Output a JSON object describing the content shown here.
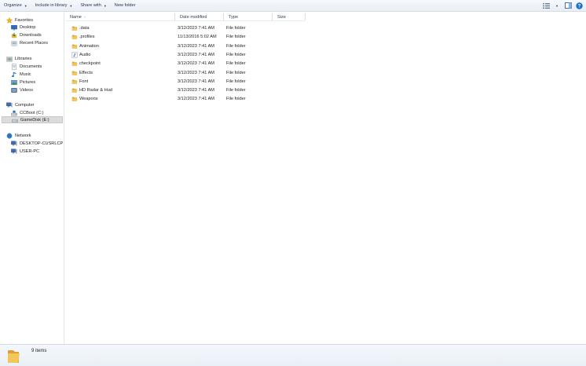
{
  "toolbar": {
    "organize": "Organize",
    "include_in_library": "Include in library",
    "share_with": "Share with",
    "new_folder": "New folder"
  },
  "sidebar": {
    "favorites": {
      "label": "Favorites",
      "items": [
        "Desktop",
        "Downloads",
        "Recent Places"
      ]
    },
    "libraries": {
      "label": "Libraries",
      "items": [
        "Documents",
        "Music",
        "Pictures",
        "Videos"
      ]
    },
    "computer": {
      "label": "Computer",
      "items": [
        "CCBoot (C:)",
        "GameDisk (E:)"
      ],
      "selected": "GameDisk (E:)"
    },
    "network": {
      "label": "Network",
      "items": [
        "DESKTOP-CUSRLCP",
        "USER-PC"
      ]
    }
  },
  "columns": {
    "name": "Name",
    "date_modified": "Date modified",
    "type": "Type",
    "size": "Size"
  },
  "files": [
    {
      "name": ".data",
      "date": "3/12/2023 7:41 AM",
      "type": "File folder",
      "icon": "folder-icon"
    },
    {
      "name": ".profiles",
      "date": "11/13/2016 5:02 AM",
      "type": "File folder",
      "icon": "folder-icon"
    },
    {
      "name": "Animation",
      "date": "3/12/2023 7:41 AM",
      "type": "File folder",
      "icon": "folder-icon"
    },
    {
      "name": "Audio",
      "date": "3/12/2023 7:41 AM",
      "type": "File folder",
      "icon": "audio-folder-icon"
    },
    {
      "name": "checkpoint",
      "date": "3/12/2023 7:41 AM",
      "type": "File folder",
      "icon": "folder-icon"
    },
    {
      "name": "Effects",
      "date": "3/12/2023 7:41 AM",
      "type": "File folder",
      "icon": "folder-icon"
    },
    {
      "name": "Font",
      "date": "3/12/2023 7:41 AM",
      "type": "File folder",
      "icon": "folder-icon"
    },
    {
      "name": "HD Radar & Hud",
      "date": "3/12/2023 7:41 AM",
      "type": "File folder",
      "icon": "folder-icon"
    },
    {
      "name": "Weapons",
      "date": "3/12/2023 7:41 AM",
      "type": "File folder",
      "icon": "folder-icon"
    }
  ],
  "status": {
    "item_count": "9 items"
  },
  "colors": {
    "folder": "#e8b844",
    "selection": "#dcdcdc",
    "toolbar": "#eef2f8",
    "help": "#1f6fd1"
  }
}
